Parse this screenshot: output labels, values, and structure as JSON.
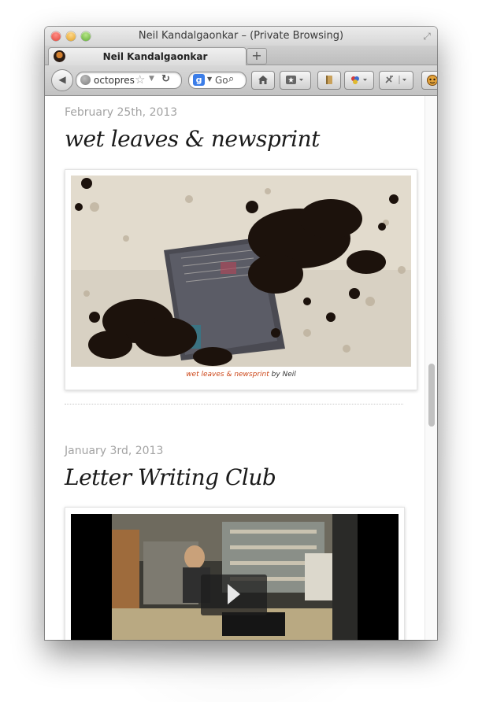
{
  "window": {
    "title": "Neil Kandalgaonkar – (Private Browsing)"
  },
  "tabs": [
    {
      "label": "Neil Kandalgaonkar"
    }
  ],
  "toolbar": {
    "url_text": "octopres",
    "search_text": "Go",
    "search_engine_letter": "g"
  },
  "posts": [
    {
      "date": "February 25th, 2013",
      "title": "wet leaves & newsprint",
      "caption_link": "wet leaves & newsprint",
      "caption_by": " by Neil"
    },
    {
      "date": "January 3rd, 2013",
      "title": "Letter Writing Club"
    }
  ],
  "colors": {
    "accent_link": "#cc4517",
    "date_gray": "#a3a3a3"
  },
  "icons": [
    "back-icon",
    "globe-icon",
    "star-icon",
    "reload-icon",
    "search-icon",
    "home-icon",
    "bookmarks-icon",
    "reader-icon",
    "extension-icon",
    "mascot-icon",
    "play-icon",
    "fullscreen-icon"
  ]
}
